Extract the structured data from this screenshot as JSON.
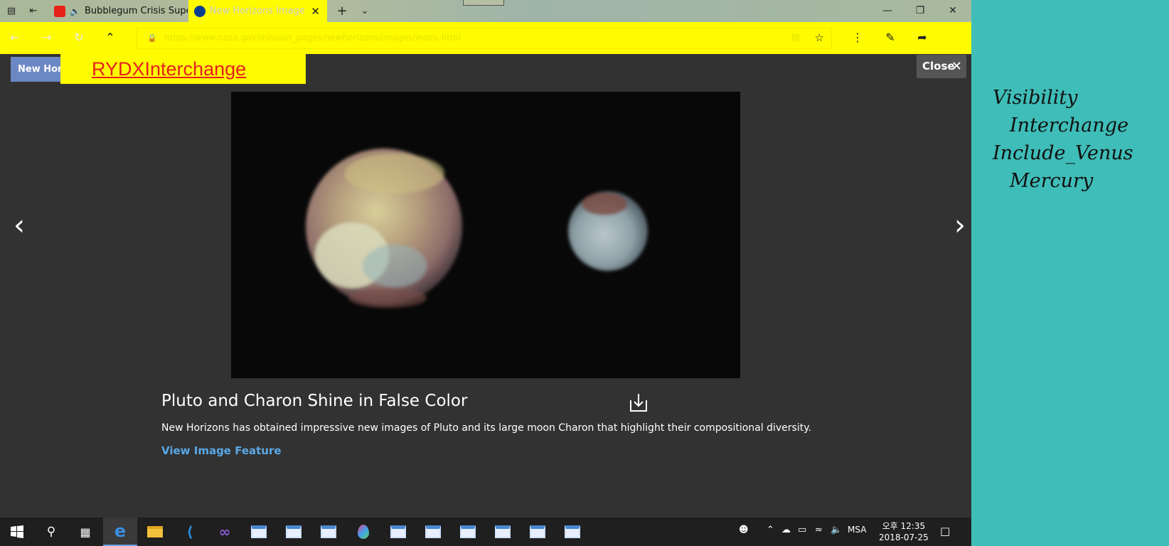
{
  "browser": {
    "tabs": [
      {
        "title": "Bubblegum Crisis Supe",
        "favicon": "youtube-icon",
        "audio": true,
        "active": false
      },
      {
        "title": "New Horizons Image",
        "favicon": "nasa-icon",
        "active": true
      }
    ],
    "url": "https://www.nasa.gov/mission_pages/newhorizons/images/index.html"
  },
  "page": {
    "site_badge": "New Hori",
    "overlay_link": "RYDXInterchange",
    "close_label": "Close",
    "caption": {
      "title": "Pluto and Charon Shine in False Color",
      "description": "New Horizons has obtained impressive new images of Pluto and its large moon Charon that highlight their compositional diversity.",
      "link": "View Image Feature"
    }
  },
  "taskbar": {
    "ime": "MSA",
    "clock_time": "오후 12:35",
    "clock_date": "2018-07-25"
  },
  "notes": [
    "Visibility",
    "Interchange",
    "Include_Venus",
    "Mercury"
  ],
  "colors": {
    "accent_yellow": "#fffb00",
    "side_teal": "#3fbdb8",
    "link_blue": "#5aa8e6",
    "overlay_red": "#e62020"
  }
}
